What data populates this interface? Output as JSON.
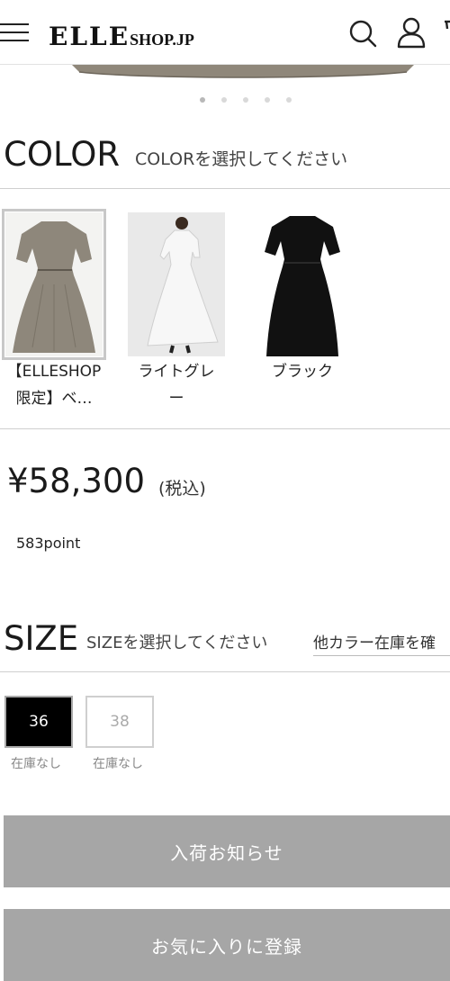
{
  "header": {
    "logo_main": "ELLE",
    "logo_sub": "SHOP.JP",
    "icons": [
      "menu-icon",
      "search-icon",
      "user-icon"
    ]
  },
  "carousel": {
    "pages": 5,
    "active": 0
  },
  "color": {
    "title": "COLOR",
    "hint": "COLORを選択してください",
    "options": [
      {
        "label_line1": "【ELLESHOP",
        "label_line2": "限定】ベ…",
        "selected": true,
        "swatch": "#8e877b"
      },
      {
        "label_line1": "ライトグレ",
        "label_line2": "ー",
        "selected": false,
        "swatch": "#e3e3e3"
      },
      {
        "label_line1": "ブラック",
        "label_line2": "",
        "selected": false,
        "swatch": "#111111"
      }
    ]
  },
  "price": {
    "amount": "¥58,300",
    "tax": "(税込)",
    "points": "583point"
  },
  "size": {
    "title": "SIZE",
    "hint": "SIZEを選択してください",
    "other_color_link": "他カラー在庫を確",
    "options": [
      {
        "label": "36",
        "stock": "在庫なし",
        "selected": true
      },
      {
        "label": "38",
        "stock": "在庫なし",
        "selected": false
      }
    ]
  },
  "buttons": {
    "notify": "入荷お知らせ",
    "favorite": "お気に入りに登録"
  },
  "colors": {
    "button_bg": "#a6a6a6",
    "selected_size_bg": "#000000"
  }
}
